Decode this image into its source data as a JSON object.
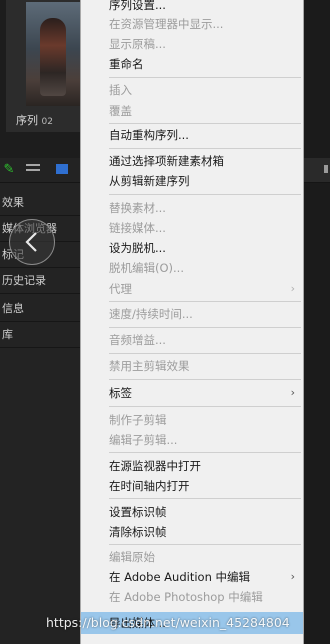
{
  "bin": {
    "clip_name": "序列",
    "clip_number": "02"
  },
  "panel_tabs": [
    "效果",
    "媒体浏览器",
    "标记",
    "历史记录",
    "信息",
    "库"
  ],
  "context_menu": {
    "items": [
      {
        "label": "序列设置...",
        "disabled": false
      },
      {
        "label": "在资源管理器中显示...",
        "disabled": true
      },
      {
        "label": "显示原稿...",
        "disabled": true
      },
      {
        "label": "重命名",
        "disabled": false
      },
      {
        "label": "插入",
        "disabled": true
      },
      {
        "label": "覆盖",
        "disabled": true
      },
      {
        "label": "自动重构序列...",
        "disabled": false
      },
      {
        "label": "通过选择项新建素材箱",
        "disabled": false
      },
      {
        "label": "从剪辑新建序列",
        "disabled": false
      },
      {
        "label": "替换素材...",
        "disabled": true
      },
      {
        "label": "链接媒体...",
        "disabled": true
      },
      {
        "label": "设为脱机...",
        "disabled": false
      },
      {
        "label": "脱机编辑(O)...",
        "disabled": true
      },
      {
        "label": "代理",
        "disabled": true,
        "submenu": true
      },
      {
        "label": "速度/持续时间...",
        "disabled": true
      },
      {
        "label": "音频增益...",
        "disabled": true
      },
      {
        "label": "禁用主剪辑效果",
        "disabled": true
      },
      {
        "label": "标签",
        "disabled": false,
        "submenu": true
      },
      {
        "label": "制作子剪辑",
        "disabled": true
      },
      {
        "label": "编辑子剪辑...",
        "disabled": true
      },
      {
        "label": "在源监视器中打开",
        "disabled": false
      },
      {
        "label": "在时间轴内打开",
        "disabled": false
      },
      {
        "label": "设置标识帧",
        "disabled": false
      },
      {
        "label": "清除标识帧",
        "disabled": false
      },
      {
        "label": "编辑原始",
        "disabled": true
      },
      {
        "label": "在 Adobe Audition 中编辑",
        "disabled": false,
        "submenu": true
      },
      {
        "label": "在 Adobe Photoshop 中编辑",
        "disabled": true
      },
      {
        "label": "导出媒体...",
        "disabled": false,
        "highlighted": true
      }
    ],
    "submenu_arrow": "›"
  },
  "watermark": "https://blog.csdn.net/weixin_45284804",
  "colors": {
    "menu_bg": "#f0f0f0",
    "highlight": "#99c6ea",
    "panel_bg": "#232323"
  },
  "icons": [
    "pencil-icon",
    "list-view-icon",
    "chevron-left-icon"
  ]
}
